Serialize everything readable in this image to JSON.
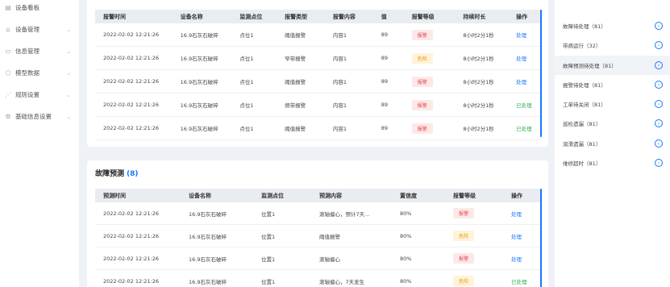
{
  "sidebar": {
    "items": [
      {
        "label": "设备看板",
        "icon": "dashboard-icon",
        "glyph": "▤",
        "chevron": ""
      },
      {
        "label": "设备管理",
        "icon": "device-icon",
        "glyph": "⌂",
        "chevron": "⌄"
      },
      {
        "label": "信息管理",
        "icon": "info-icon",
        "glyph": "▭",
        "chevron": "⌄"
      },
      {
        "label": "模型数据",
        "icon": "model-icon",
        "glyph": "⬡",
        "chevron": "⌄"
      },
      {
        "label": "规则设置",
        "icon": "rule-icon",
        "glyph": "⋰",
        "chevron": "⌄"
      },
      {
        "label": "基础信息设置",
        "icon": "settings-icon",
        "glyph": "⚙",
        "chevron": "⌄"
      }
    ]
  },
  "alarms": {
    "columns": [
      "报警时间",
      "设备名称",
      "监测点位",
      "报警类型",
      "报警内容",
      "值",
      "报警等级",
      "持续时长",
      "操作"
    ],
    "rows": [
      {
        "time": "2022-02-02  12:21:26",
        "device": "16.9石灰石破碎",
        "point": "点位1",
        "type": "阈值报警",
        "content": "内容1",
        "value": "89",
        "level": "报警",
        "level_color": "red",
        "duration": "8小时2分1秒",
        "action": "处理",
        "action_color": "blue"
      },
      {
        "time": "2022-02-02  12:21:26",
        "device": "16.9石灰石破碎",
        "point": "点位1",
        "type": "窄带报警",
        "content": "内容1",
        "value": "89",
        "level": "危险",
        "level_color": "yellow",
        "duration": "8小时2分1秒",
        "action": "处理",
        "action_color": "blue"
      },
      {
        "time": "2022-02-02  12:21:26",
        "device": "16.9石灰石破碎",
        "point": "点位1",
        "type": "阈值报警",
        "content": "内容1",
        "value": "89",
        "level": "报警",
        "level_color": "red",
        "duration": "8小时2分1秒",
        "action": "处理",
        "action_color": "blue"
      },
      {
        "time": "2022-02-02  12:21:26",
        "device": "16.9石灰石破碎",
        "point": "点位1",
        "type": "频带报警",
        "content": "内容1",
        "value": "89",
        "level": "报警",
        "level_color": "red",
        "duration": "8小时2分1秒",
        "action": "已处理",
        "action_color": "green"
      },
      {
        "time": "2022-02-02  12:21:26",
        "device": "16.9石灰石破碎",
        "point": "点位1",
        "type": "阈值报警",
        "content": "内容1",
        "value": "89",
        "level": "报警",
        "level_color": "red",
        "duration": "8小时2分1秒",
        "action": "已处理",
        "action_color": "green"
      }
    ]
  },
  "fault": {
    "title": "故障预测",
    "count": "(8)",
    "columns": [
      "预测时间",
      "设备名称",
      "监测点位",
      "预测内容",
      "置信度",
      "报警等级",
      "操作"
    ],
    "rows": [
      {
        "time": "2022-02-02  12:21:26",
        "device": "16.9石灰石破碎",
        "point": "位置1",
        "content": "滚轴偏心，预计7天...",
        "confidence": "80%",
        "level": "报警",
        "level_color": "red",
        "action": "处理",
        "action_color": "blue"
      },
      {
        "time": "2022-02-02  12:21:26",
        "device": "16.9石灰石破碎",
        "point": "位置1",
        "content": "阈值报警",
        "confidence": "80%",
        "level": "危险",
        "level_color": "yellow",
        "action": "处理",
        "action_color": "blue"
      },
      {
        "time": "2022-02-02  12:21:26",
        "device": "16.9石灰石破碎",
        "point": "位置1",
        "content": "滚轴偏心",
        "confidence": "80%",
        "level": "报警",
        "level_color": "red",
        "action": "处理",
        "action_color": "blue"
      },
      {
        "time": "2022-02-02  12:21:26",
        "device": "16.9石灰石破碎",
        "point": "位置1",
        "content": "滚轴偏心，7天发生",
        "confidence": "80%",
        "level": "危险",
        "level_color": "yellow",
        "action": "已处理",
        "action_color": "green"
      }
    ]
  },
  "right_panel": {
    "items": [
      {
        "label": "故障待处理（81）",
        "active": false
      },
      {
        "label": "带病运行（32）",
        "active": false
      },
      {
        "label": "故障预测待处理（81）",
        "active": true
      },
      {
        "label": "报警待处理（81）",
        "active": false
      },
      {
        "label": "工单待关闭（81）",
        "active": false
      },
      {
        "label": "巡检遗漏（81）",
        "active": false
      },
      {
        "label": "润滑遗漏（81）",
        "active": false
      },
      {
        "label": "维修超时（81）",
        "active": false
      }
    ],
    "arrow_glyph": "›"
  },
  "colors": {
    "accent": "#1677ff",
    "danger": "#e5484d",
    "warning": "#e89a0c",
    "success": "#2bb24c"
  }
}
